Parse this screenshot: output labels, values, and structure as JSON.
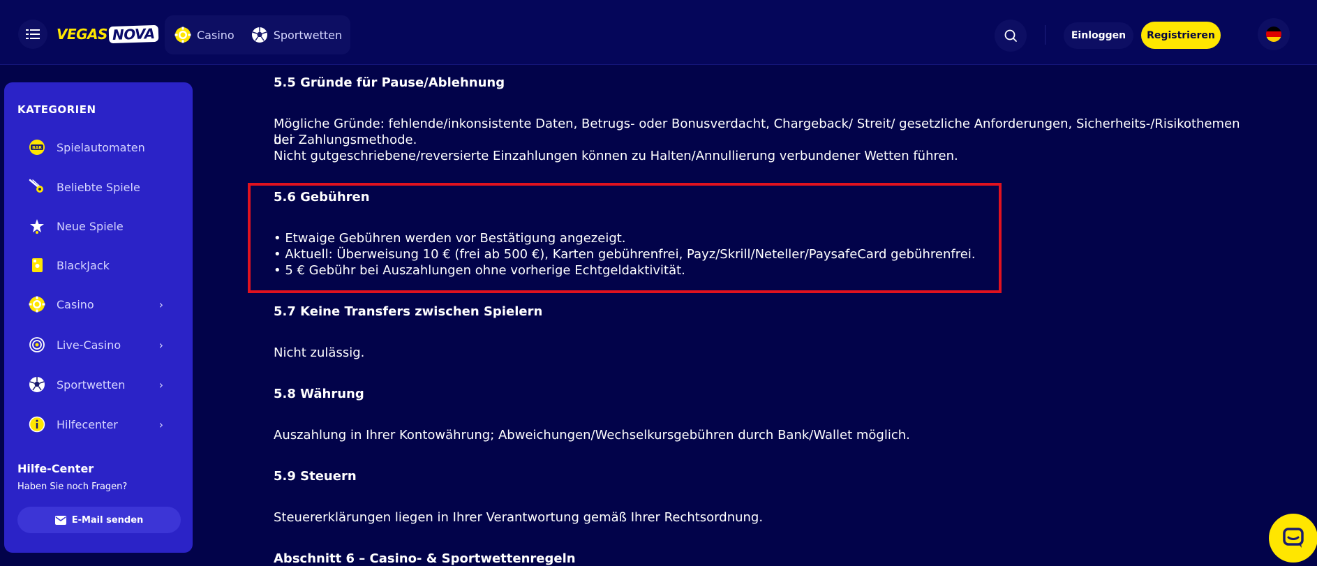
{
  "header": {
    "logo_left": "VEGAS",
    "logo_right": "NOVA",
    "nav": [
      {
        "label": "Casino",
        "icon": "poker-chip-icon"
      },
      {
        "label": "Sportwetten",
        "icon": "soccer-ball-icon"
      }
    ],
    "login_label": "Einloggen",
    "register_label": "Registrieren",
    "language_flag": "de-flag-icon"
  },
  "sidebar": {
    "title": "KATEGORIEN",
    "items": [
      {
        "label": "Spielautomaten",
        "icon": "slot-bar-icon",
        "has_chevron": false
      },
      {
        "label": "Beliebte Spiele",
        "icon": "comet-icon",
        "has_chevron": false
      },
      {
        "label": "Neue Spiele",
        "icon": "star-icon",
        "has_chevron": false
      },
      {
        "label": "BlackJack",
        "icon": "card-icon",
        "has_chevron": false
      },
      {
        "label": "Casino",
        "icon": "poker-chip-icon",
        "has_chevron": true
      },
      {
        "label": "Live-Casino",
        "icon": "live-icon",
        "has_chevron": true
      },
      {
        "label": "Sportwetten",
        "icon": "soccer-ball-icon",
        "has_chevron": true
      },
      {
        "label": "Hilfecenter",
        "icon": "info-icon",
        "has_chevron": true
      }
    ],
    "help": {
      "title": "Hilfe-Center",
      "subtitle": "Haben Sie noch Fragen?",
      "button_label": "E-Mail senden"
    }
  },
  "content": {
    "s55_title": "5.5 Gründe für Pause/Ablehnung",
    "s55_line1": "Mögliche Gründe: fehlende/inkonsistente Daten, Betrugs- oder Bonusverdacht, Chargeback/ Streit/ gesetzliche Anforderungen, Sicherheits-/Risikothemen bei",
    "s55_line2": "der Zahlungsmethode.",
    "s55_line3": "Nicht gutgeschriebene/reversierte Einzahlungen können zu Halten/Annullierung verbundener Wetten führen.",
    "s56_title": "5.6 Gebühren",
    "s56_line1": "• Etwaige Gebühren werden vor Bestätigung angezeigt.",
    "s56_line2": "• Aktuell: Überweisung 10 € (frei ab 500 €), Karten gebührenfrei, Payz/Skrill/Neteller/PaysafeCard gebührenfrei.",
    "s56_line3": "• 5 € Gebühr bei Auszahlungen ohne vorherige Echtgeldaktivität.",
    "s57_title": "5.7 Keine Transfers zwischen Spielern",
    "s57_text": "Nicht zulässig.",
    "s58_title": "5.8 Währung",
    "s58_text": "Auszahlung in Ihrer Kontowährung; Abweichungen/Wechselkursgebühren durch Bank/Wallet möglich.",
    "s59_title": "5.9 Steuern",
    "s59_text": "Steuererklärungen liegen in Ihrer Verantwortung gemäß Ihrer Rechtsordnung.",
    "s6_title": "Abschnitt 6 – Casino- & Sportwettenregeln"
  },
  "colors": {
    "background": "#02034a",
    "sidebar": "#2b23c7",
    "accent_yellow": "#ffe600",
    "highlight_red": "#e0121f"
  }
}
